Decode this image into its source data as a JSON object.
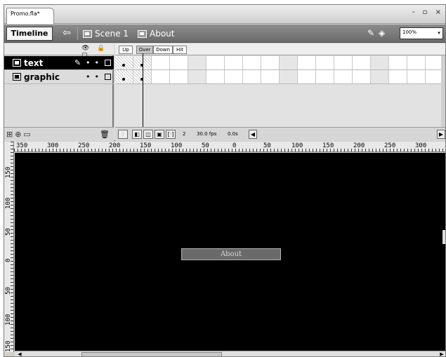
{
  "window": {
    "doc_tab": "Promo.fla*",
    "controls": "- ▫ ×"
  },
  "editbar": {
    "timeline_label": "Timeline",
    "back_symbol": "⇦",
    "scene_label": "Scene 1",
    "symbol_label": "About",
    "zoom_value": "100%"
  },
  "layers": {
    "header_icons": "👁 🔒 ▢",
    "items": [
      {
        "name": "text",
        "selected": true
      },
      {
        "name": "graphic",
        "selected": false
      }
    ]
  },
  "frames": {
    "labels": [
      "Up",
      "Over",
      "Down",
      "Hit"
    ],
    "status": {
      "frame": "2",
      "fps": "30.0 fps",
      "time": "0.0s"
    }
  },
  "ruler": {
    "h_labels": [
      "350",
      "300",
      "250",
      "200",
      "150",
      "100",
      "50",
      "0",
      "50",
      "100",
      "150",
      "200",
      "250",
      "300"
    ],
    "v_labels": [
      "150",
      "100",
      "50",
      "0",
      "50",
      "100",
      "150"
    ]
  },
  "stage": {
    "background": "#000000",
    "button_text": "About"
  }
}
